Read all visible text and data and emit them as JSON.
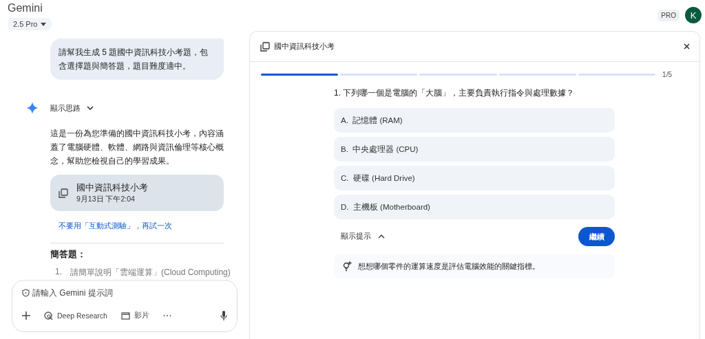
{
  "app": {
    "title": "Gemini",
    "model": "2.5 Pro",
    "plan_badge": "PRO",
    "avatar_letter": "K"
  },
  "chat": {
    "user_message": "請幫我生成 5 題國中資訊科技小考題，包含選擇題與簡答題，題目難度適中。",
    "thoughts_toggle": {
      "label": "顯示思路",
      "expanded": false
    },
    "response_text": "這是一份為您準備的國中資訊科技小考，內容涵蓋了電腦硬體、軟體、網路與資訊倫理等核心概念，幫助您檢視自己的學習成果。",
    "quiz_card": {
      "title": "國中資訊科技小考",
      "timestamp": "9月13日 下午2:04"
    },
    "retry_link": "不要用「互動式測驗」，再試一次",
    "section_heading": "簡答題：",
    "list_items": [
      {
        "number": "1.",
        "text": "請簡單說明「雲端運算」(Cloud Computing)"
      }
    ]
  },
  "prompt_box": {
    "placeholder": "請輸入 Gemini 提示詞",
    "tools": [
      {
        "kind": "add"
      },
      {
        "kind": "research",
        "label": "Deep Research"
      },
      {
        "kind": "video",
        "label": "影片"
      },
      {
        "kind": "more",
        "label": "···"
      },
      {
        "kind": "mic"
      }
    ]
  },
  "quiz_panel": {
    "title": "國中資訊科技小考",
    "progress": {
      "segments": [
        {
          "filled": true
        },
        {
          "filled": false
        },
        {
          "filled": false
        },
        {
          "filled": false
        },
        {
          "filled": false
        }
      ],
      "counter": "1/5"
    },
    "question": "1. 下列哪一個是電腦的「大腦」，主要負責執行指令與處理數據？",
    "options": [
      {
        "letter": "A.",
        "text": "記憶體 (RAM)",
        "selected": false
      },
      {
        "letter": "B.",
        "text": "中央處理器 (CPU)",
        "selected": false
      },
      {
        "letter": "C.",
        "text": "硬碟 (Hard Drive)",
        "selected": false
      },
      {
        "letter": "D.",
        "text": "主機板 (Motherboard)",
        "selected": false
      }
    ],
    "hint_toggle": {
      "label": "顯示提示",
      "expanded": true
    },
    "continue_button": "繼續",
    "hint": "想想哪個零件的運算速度是評估電腦效能的關鍵指標。"
  }
}
